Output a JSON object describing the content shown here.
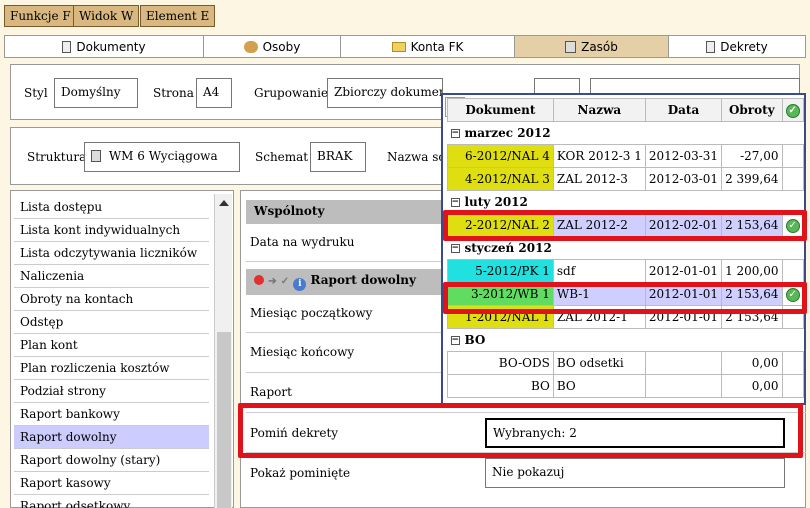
{
  "top_buttons": [
    "Funkcje F",
    "Widok W",
    "Element E"
  ],
  "tabs": [
    {
      "label": "Dokumenty",
      "icon": "document-icon"
    },
    {
      "label": "Osoby",
      "icon": "people-icon"
    },
    {
      "label": "Konta FK",
      "icon": "folder-icon"
    },
    {
      "label": "Zasób",
      "icon": "resource-icon"
    },
    {
      "label": "Dekrety",
      "icon": "decree-icon"
    }
  ],
  "settings": {
    "styl_label": "Styl",
    "styl_value": "Domyślny",
    "strona_label": "Strona",
    "strona_value": "A4",
    "grupowanie_label": "Grupowanie",
    "grupowanie_value": "Zbiorczy dokument",
    "struktura_label": "Struktura",
    "struktura_value": "WM 6 Wyciągowa",
    "schemat_label": "Schemat",
    "schemat_value": "BRAK",
    "nazwa_label": "Nazwa sch"
  },
  "report_list": [
    "Lista dostępu",
    "Lista kont indywidualnych",
    "Lista odczytywania liczników",
    "Naliczenia",
    "Obroty na kontach",
    "Odstęp",
    "Plan kont",
    "Plan rozliczenia kosztów",
    "Podział strony",
    "Raport bankowy",
    "Raport dowolny",
    "Raport dowolny (stary)",
    "Raport kasowy",
    "Raport odsetkowy"
  ],
  "selected_report": "Raport dowolny",
  "wspolnoty": {
    "title": "Wspólnoty",
    "data_label": "Data na wydruku"
  },
  "raport": {
    "title": "Raport dowolny",
    "miesiac_pocz": "Miesiąc początkowy",
    "miesiac_konc": "Miesiąc końcowy",
    "raport_label": "Raport",
    "pomin_label": "Pomiń dekrety",
    "pomin_value": "Wybranych: 2",
    "pokaz_label": "Pokaż pominięte",
    "pokaz_value": "Nie pokazuj"
  },
  "popup": {
    "headers": [
      "Dokument",
      "Nazwa",
      "Data",
      "Obroty"
    ],
    "groups": [
      {
        "name": "marzec 2012",
        "rows": [
          {
            "doc": "6-2012/NAL 4",
            "nazwa": "KOR 2012-3 1",
            "data": "2012-03-31",
            "obroty": "-27,00",
            "color": "y",
            "ok": false
          },
          {
            "doc": "4-2012/NAL 3",
            "nazwa": "ZAL 2012-3",
            "data": "2012-03-01",
            "obroty": "2 399,64",
            "color": "y",
            "ok": false
          }
        ]
      },
      {
        "name": "luty 2012",
        "rows": [
          {
            "doc": "2-2012/NAL 2",
            "nazwa": "ZAL 2012-2",
            "data": "2012-02-01",
            "obroty": "2 153,64",
            "color": "y",
            "ok": true
          }
        ]
      },
      {
        "name": "styczeń 2012",
        "rows": [
          {
            "doc": "5-2012/PK 1",
            "nazwa": "sdf",
            "data": "2012-01-01",
            "obroty": "1 200,00",
            "color": "c",
            "ok": false
          },
          {
            "doc": "3-2012/WB 1",
            "nazwa": "WB-1",
            "data": "2012-01-01",
            "obroty": "2 153,64",
            "color": "g",
            "ok": true
          },
          {
            "doc": "1-2012/NAL 1",
            "nazwa": "ZAL 2012-1",
            "data": "2012-01-01",
            "obroty": "2 153,64",
            "color": "y",
            "ok": false
          }
        ]
      },
      {
        "name": "BO",
        "rows": [
          {
            "doc": "BO-ODS",
            "nazwa": "BO odsetki",
            "data": "",
            "obroty": "0,00",
            "color": "",
            "ok": false
          },
          {
            "doc": "BO",
            "nazwa": "BO",
            "data": "",
            "obroty": "0,00",
            "color": "",
            "ok": false
          }
        ]
      }
    ]
  }
}
